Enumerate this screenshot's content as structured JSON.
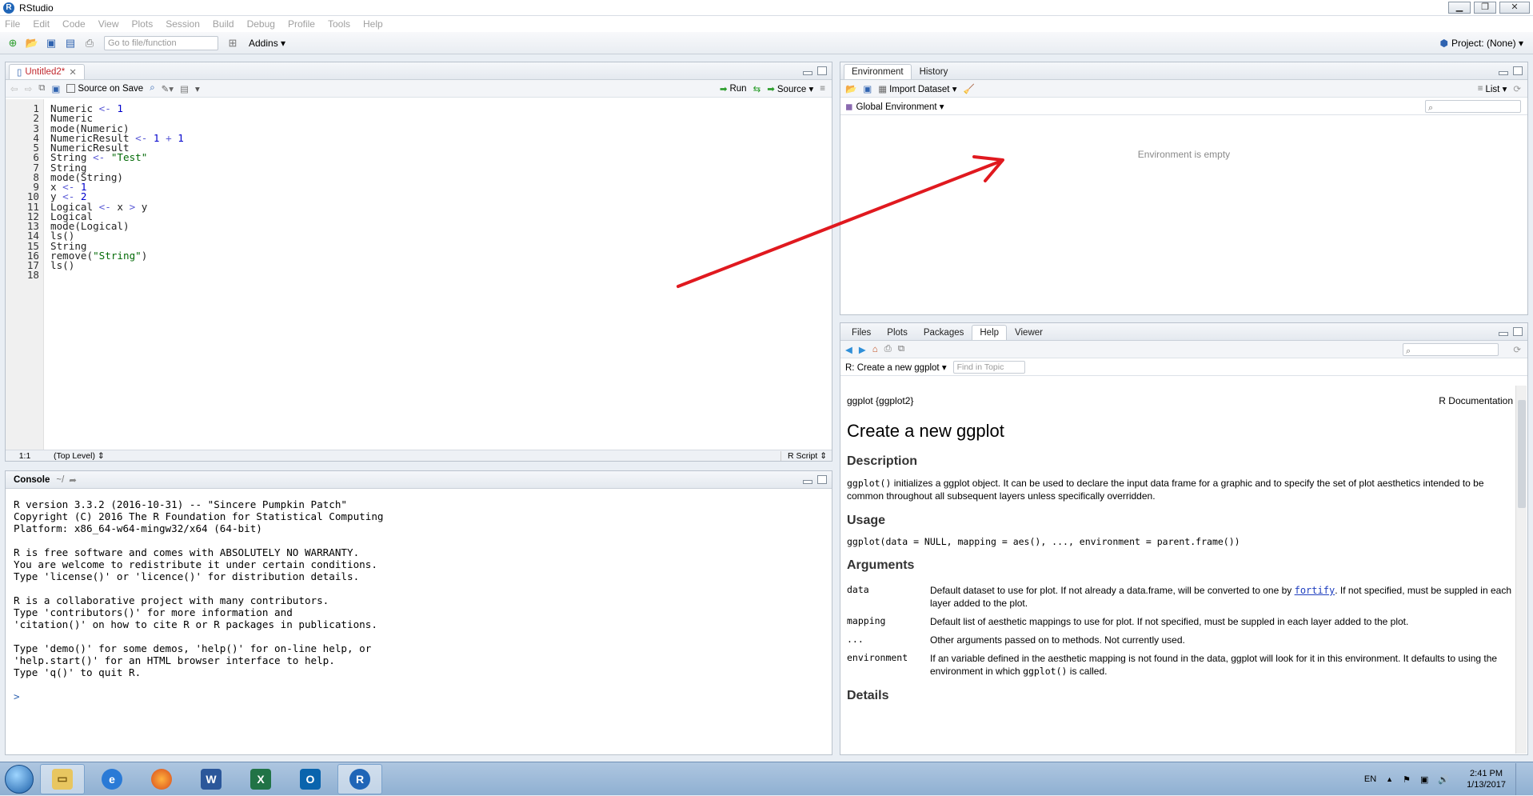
{
  "window": {
    "title": "RStudio",
    "btn_min": "▁",
    "btn_max": "❐",
    "btn_close": "✕"
  },
  "menu": [
    "File",
    "Edit",
    "Code",
    "View",
    "Plots",
    "Session",
    "Build",
    "Debug",
    "Profile",
    "Tools",
    "Help"
  ],
  "toolbar": {
    "goto_placeholder": "Go to file/function",
    "addins": "Addins ▾",
    "project": "Project: (None) ▾"
  },
  "editor": {
    "tab": "Untitled2*",
    "source_on_save": "Source on Save",
    "run": "Run",
    "source": "Source ▾",
    "status_pos": "1:1",
    "status_scope": "(Top Level) ⇕",
    "status_type": "R Script ⇕",
    "lines": [
      [
        [
          "kw",
          "Numeric "
        ],
        [
          "op",
          "<-"
        ],
        [
          "num",
          " 1"
        ]
      ],
      [
        [
          "kw",
          "Numeric"
        ]
      ],
      [
        [
          "kw",
          "mode(Numeric)"
        ]
      ],
      [
        [
          "kw",
          "NumericResult "
        ],
        [
          "op",
          "<-"
        ],
        [
          "num",
          " 1 "
        ],
        [
          "op",
          "+"
        ],
        [
          "num",
          " 1"
        ]
      ],
      [
        [
          "kw",
          "NumericResult"
        ]
      ],
      [
        [
          "kw",
          "String "
        ],
        [
          "op",
          "<-"
        ],
        [
          "str",
          " \"Test\""
        ]
      ],
      [
        [
          "kw",
          "String"
        ]
      ],
      [
        [
          "kw",
          "mode(String)"
        ]
      ],
      [
        [
          "kw",
          "x "
        ],
        [
          "op",
          "<-"
        ],
        [
          "num",
          " 1"
        ]
      ],
      [
        [
          "kw",
          "y "
        ],
        [
          "op",
          "<-"
        ],
        [
          "num",
          " 2"
        ]
      ],
      [
        [
          "kw",
          "Logical "
        ],
        [
          "op",
          "<-"
        ],
        [
          "kw",
          " x "
        ],
        [
          "op",
          ">"
        ],
        [
          "kw",
          " y"
        ]
      ],
      [
        [
          "kw",
          "Logical"
        ]
      ],
      [
        [
          "kw",
          "mode(Logical)"
        ]
      ],
      [
        [
          "kw",
          "ls()"
        ]
      ],
      [
        [
          "kw",
          "String"
        ]
      ],
      [
        [
          "kw",
          "remove("
        ],
        [
          "str",
          "\"String\""
        ],
        [
          "kw",
          ")"
        ]
      ],
      [
        [
          "kw",
          "ls()"
        ]
      ],
      []
    ]
  },
  "console": {
    "title": "Console",
    "path": "~/",
    "text": "R version 3.3.2 (2016-10-31) -- \"Sincere Pumpkin Patch\"\nCopyright (C) 2016 The R Foundation for Statistical Computing\nPlatform: x86_64-w64-mingw32/x64 (64-bit)\n\nR is free software and comes with ABSOLUTELY NO WARRANTY.\nYou are welcome to redistribute it under certain conditions.\nType 'license()' or 'licence()' for distribution details.\n\nR is a collaborative project with many contributors.\nType 'contributors()' for more information and\n'citation()' on how to cite R or R packages in publications.\n\nType 'demo()' for some demos, 'help()' for on-line help, or\n'help.start()' for an HTML browser interface to help.\nType 'q()' to quit R.\n",
    "prompt": ">"
  },
  "env": {
    "tabs": [
      "Environment",
      "History"
    ],
    "import": "Import Dataset ▾",
    "list": "List ▾",
    "scope": "Global Environment ▾",
    "empty": "Environment is empty"
  },
  "help": {
    "tabs": [
      "Files",
      "Plots",
      "Packages",
      "Help",
      "Viewer"
    ],
    "topic": "R: Create a new ggplot ▾",
    "find_placeholder": "Find in Topic",
    "pkg": "ggplot {ggplot2}",
    "rdoc": "R Documentation",
    "title": "Create a new ggplot",
    "desc_h": "Description",
    "desc_code": "ggplot()",
    "desc_text": " initializes a ggplot object. It can be used to declare the input data frame for a graphic and to specify the set of plot aesthetics intended to be common throughout all subsequent layers unless specifically overridden.",
    "usage_h": "Usage",
    "usage": "ggplot(data = NULL, mapping = aes(), ..., environment = parent.frame())",
    "args_h": "Arguments",
    "arg1_name": "data",
    "arg1_a": "Default dataset to use for plot. If not already a data.frame, will be converted to one by ",
    "arg1_link": "fortify",
    "arg1_b": ". If not specified, must be suppled in each layer added to the plot.",
    "arg2_name": "mapping",
    "arg2": "Default list of aesthetic mappings to use for plot. If not specified, must be suppled in each layer added to the plot.",
    "arg3_name": "...",
    "arg3": "Other arguments passed on to methods. Not currently used.",
    "arg4_name": "environment",
    "arg4_a": "If an variable defined in the aesthetic mapping is not found in the data, ggplot will look for it in this environment. It defaults to using the environment in which ",
    "arg4_code": "ggplot()",
    "arg4_b": " is called.",
    "details_h": "Details"
  },
  "taskbar": {
    "lang": "EN",
    "time": "2:41 PM",
    "date": "1/13/2017",
    "tray_up": "▲"
  },
  "colors": {
    "accent": "#1f65b7",
    "arrow": "#e0191f"
  }
}
